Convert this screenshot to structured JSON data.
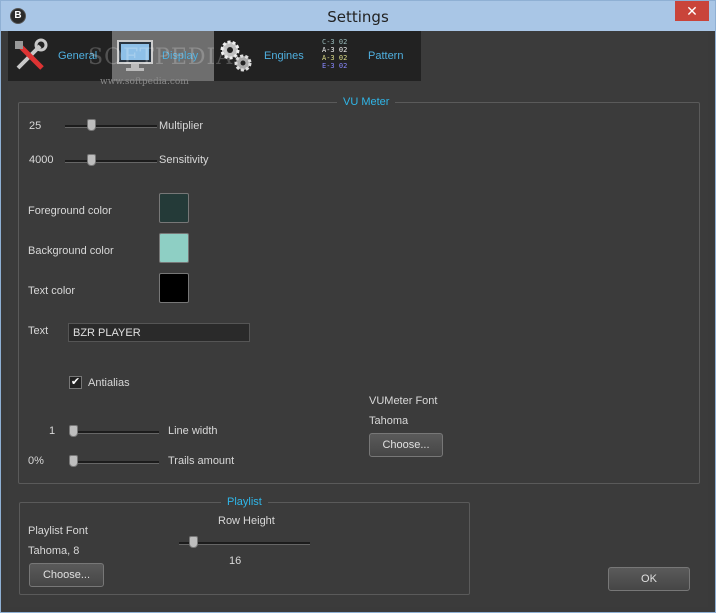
{
  "window": {
    "title": "Settings",
    "app_icon_letter": "B",
    "close_symbol": "✕"
  },
  "tabs": [
    {
      "label": "General",
      "icon": "tools-icon"
    },
    {
      "label": "Display",
      "icon": "monitor-icon"
    },
    {
      "label": "Engines",
      "icon": "gears-icon"
    },
    {
      "label": "Pattern",
      "icon": "pattern-icon"
    }
  ],
  "pattern_icon_lines": [
    "C-3 02",
    "A-3 02",
    "A-3 02",
    "E-3 02"
  ],
  "watermark": {
    "text": "SOFTPEDIA",
    "url": "www.softpedia.com"
  },
  "vu_meter": {
    "title": "VU Meter",
    "multiplier": {
      "value": "25",
      "label": "Multiplier",
      "level": 0.26
    },
    "sensitivity": {
      "value": "4000",
      "label": "Sensitivity",
      "level": 0.26
    },
    "foreground_color": {
      "label": "Foreground color",
      "color": "#243a38"
    },
    "background_color": {
      "label": "Background color",
      "color": "#8ecfc4"
    },
    "text_color": {
      "label": "Text color",
      "color": "#000000"
    },
    "text": {
      "label": "Text",
      "value": "BZR PLAYER"
    },
    "antialias": {
      "label": "Antialias",
      "checked": true
    },
    "line_width": {
      "value": "1",
      "label": "Line width",
      "level": 0.0
    },
    "trails_amount": {
      "value": "0%",
      "label": "Trails amount",
      "level": 0.0
    },
    "font": {
      "label": "VUMeter Font",
      "value": "Tahoma",
      "button": "Choose..."
    }
  },
  "playlist": {
    "title": "Playlist",
    "font": {
      "label": "Playlist Font",
      "value": "Tahoma, 8",
      "button": "Choose..."
    },
    "row_height": {
      "label": "Row Height",
      "value": "16",
      "level": 0.08
    }
  },
  "ok_button": "OK"
}
